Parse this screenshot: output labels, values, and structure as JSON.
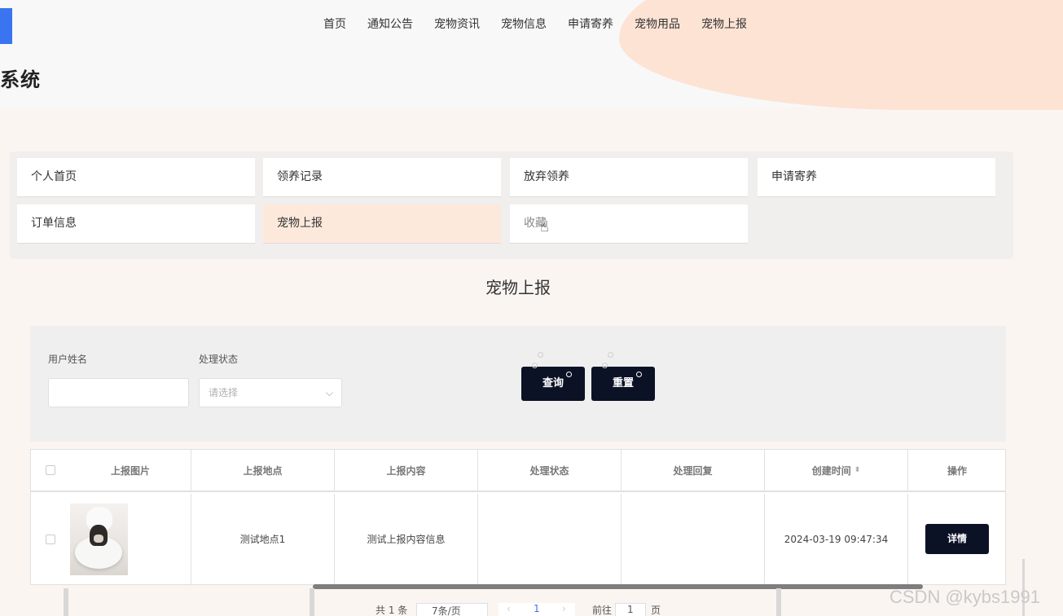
{
  "header": {
    "system_title": "系统",
    "nav": [
      "首页",
      "通知公告",
      "宠物资讯",
      "宠物信息",
      "申请寄养",
      "宠物用品",
      "宠物上报"
    ]
  },
  "menu": {
    "items": [
      "个人首页",
      "领养记录",
      "放弃领养",
      "申请寄养",
      "订单信息",
      "宠物上报",
      "收藏"
    ],
    "active": "宠物上报"
  },
  "section_title": "宠物上报",
  "search": {
    "username_label": "用户姓名",
    "username_value": "",
    "status_label": "处理状态",
    "status_placeholder": "请选择",
    "query_button": "查询",
    "reset_button": "重置"
  },
  "table": {
    "headers": [
      "上报图片",
      "上报地点",
      "上报内容",
      "处理状态",
      "处理回复",
      "创建时间",
      "操作"
    ],
    "rows": [
      {
        "location": "测试地点1",
        "content": "测试上报内容信息",
        "status": "",
        "reply": "",
        "created": "2024-03-19 09:47:34",
        "action": "详情"
      }
    ]
  },
  "pagination": {
    "total": "共 1 条",
    "page_size": "7条/页",
    "current_page": "1",
    "goto_label": "前往",
    "goto_value": "1",
    "page_unit": "页"
  },
  "watermark": "CSDN @kybs1991",
  "colors": {
    "accent": "#0b1226",
    "active_tile": "#fde9dc",
    "blob": "#fde3d4"
  }
}
